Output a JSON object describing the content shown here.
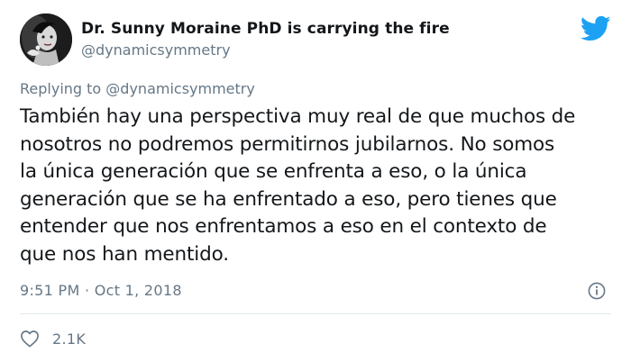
{
  "tweet": {
    "author": {
      "display_name": "Dr. Sunny Moraine PhD is carrying the fire",
      "handle": "@dynamicsymmetry"
    },
    "replying_to": {
      "prefix": "Replying to",
      "mention": "@dynamicsymmetry"
    },
    "text_lines": [
      "También hay una perspectiva muy real de que muchos de",
      "nosotros no podremos permitirnos jubilarnos. No somos",
      "la única generación que se enfrenta a eso, o la única",
      "generación que se ha enfrentado a eso, pero tienes que",
      "entender que nos enfrentamos a eso en el contexto de",
      "que nos han mentido."
    ],
    "timestamp": "9:51 PM · Oct 1, 2018",
    "likes_count": "2.1K"
  },
  "icons": {
    "brand": "twitter-bird-icon",
    "info": "info-icon",
    "like": "heart-icon"
  },
  "colors": {
    "brand_blue": "#1da1f2",
    "secondary_text": "#657786",
    "primary_text": "#14171a",
    "divider": "#e1e8ed"
  }
}
